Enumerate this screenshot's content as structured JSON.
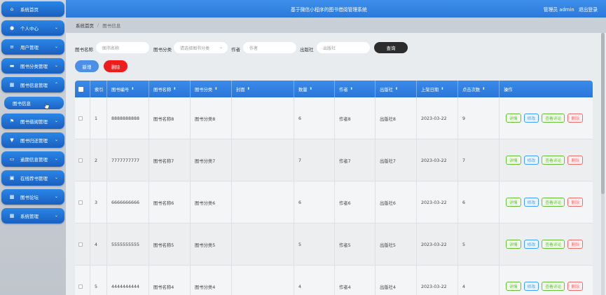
{
  "header": {
    "title": "基于微信小程序的图书借阅管理系统",
    "role": "管理员 admin",
    "logout": "退出登录"
  },
  "breadcrumb": {
    "home": "系统首页",
    "sep": "/",
    "current": "图书信息"
  },
  "sidebar": {
    "items": [
      {
        "label": "系统首页",
        "icon": "home-icon",
        "glyph": "⌂"
      },
      {
        "label": "个人中心",
        "icon": "user-icon",
        "glyph": "●"
      },
      {
        "label": "用户管理",
        "icon": "list-icon",
        "glyph": "≡"
      },
      {
        "label": "图书分类管理",
        "icon": "folder-icon",
        "glyph": "▬"
      },
      {
        "label": "图书信息管理",
        "icon": "grid-icon",
        "glyph": "▦"
      },
      {
        "label": "图书借阅管理",
        "icon": "flag-icon",
        "glyph": "⚑"
      },
      {
        "label": "图书归还管理",
        "icon": "cup-icon",
        "glyph": "▼"
      },
      {
        "label": "逾期信息管理",
        "icon": "doc-icon",
        "glyph": "▭"
      },
      {
        "label": "在线荐书管理",
        "icon": "book-icon",
        "glyph": "▣"
      },
      {
        "label": "图书论坛",
        "icon": "chat-icon",
        "glyph": "▩"
      },
      {
        "label": "系统管理",
        "icon": "settings-icon",
        "glyph": "▦"
      }
    ],
    "submenu": "图书信息"
  },
  "search": {
    "name_label": "图书名称",
    "name_placeholder": "图书名称",
    "cat_label": "图书分类",
    "cat_placeholder": "请选择图书分类",
    "author_label": "作者",
    "author_placeholder": "作者",
    "pub_label": "出版社",
    "pub_placeholder": "出版社",
    "button": "查询"
  },
  "actions": {
    "add": "新增",
    "delete": "删除"
  },
  "table": {
    "columns": [
      "索引",
      "图书编号",
      "图书名称",
      "图书分类",
      "封面",
      "数量",
      "作者",
      "出版社",
      "上架日期",
      "点击次数",
      "操作"
    ],
    "rows": [
      {
        "idx": "1",
        "no": "8888888888",
        "name": "图书名称8",
        "cat": "图书分类8",
        "qty": "6",
        "author": "作者8",
        "pub": "出版社8",
        "date": "2023-03-22",
        "clicks": "9"
      },
      {
        "idx": "2",
        "no": "7777777777",
        "name": "图书名称7",
        "cat": "图书分类7",
        "qty": "7",
        "author": "作者7",
        "pub": "出版社7",
        "date": "2023-03-22",
        "clicks": "7"
      },
      {
        "idx": "3",
        "no": "6666666666",
        "name": "图书名称6",
        "cat": "图书分类6",
        "qty": "6",
        "author": "作者6",
        "pub": "出版社6",
        "date": "2023-03-22",
        "clicks": "6"
      },
      {
        "idx": "4",
        "no": "5555555555",
        "name": "图书名称5",
        "cat": "图书分类5",
        "qty": "5",
        "author": "作者5",
        "pub": "出版社5",
        "date": "2023-03-22",
        "clicks": "5"
      },
      {
        "idx": "5",
        "no": "4444444444",
        "name": "图书名称4",
        "cat": "图书分类4",
        "qty": "4",
        "author": "作者4",
        "pub": "出版社4",
        "date": "2023-03-22",
        "clicks": "4"
      }
    ],
    "row_actions": {
      "detail": "详情",
      "edit": "修改",
      "review": "查看评论",
      "delete": "删除"
    }
  },
  "colors": {
    "primary": "#2c79dc",
    "danger": "#ee1c1c",
    "dark": "#2c2c2c"
  }
}
